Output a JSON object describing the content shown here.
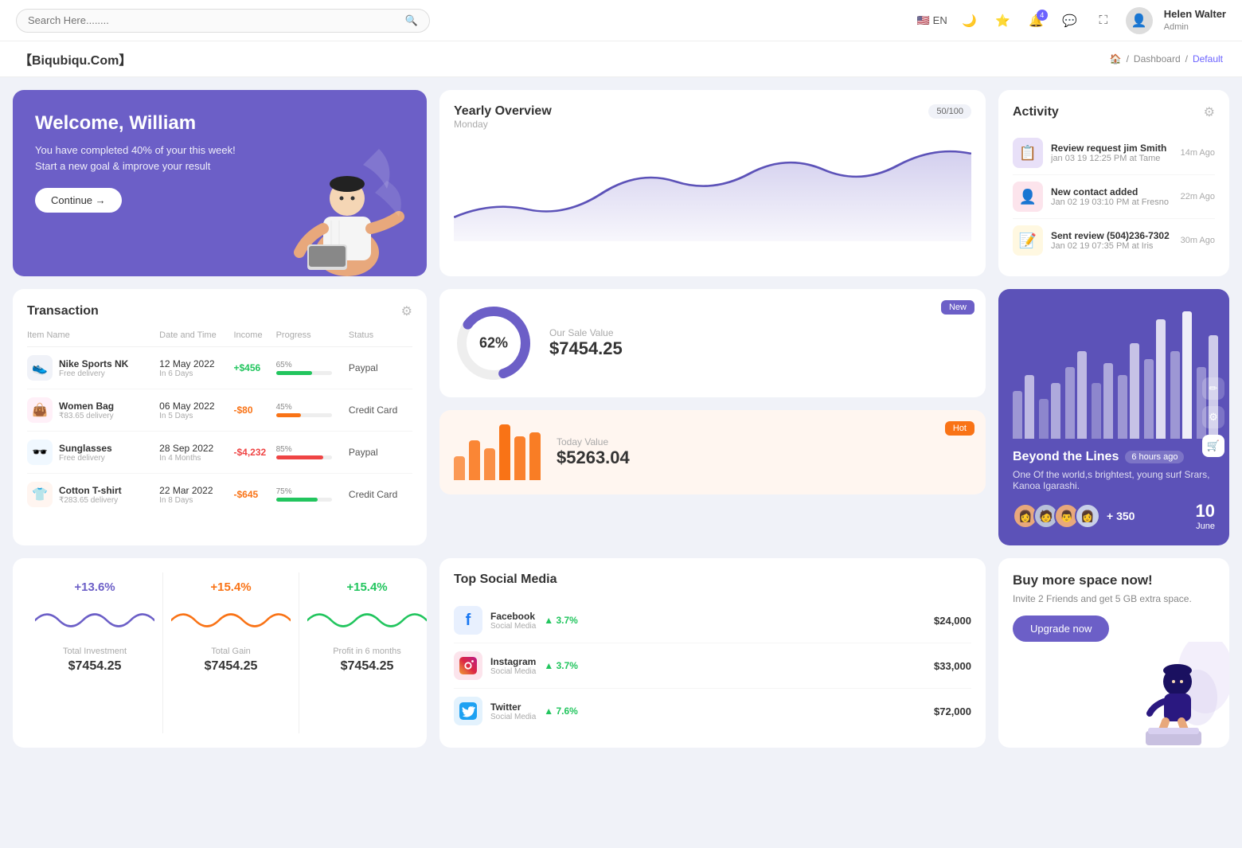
{
  "topnav": {
    "search_placeholder": "Search Here........",
    "lang": "EN",
    "notification_count": "4",
    "user_name": "Helen Walter",
    "user_role": "Admin"
  },
  "breadcrumb": {
    "logo": "【Biqubiqu.Com】",
    "home": "Home",
    "dashboard": "Dashboard",
    "current": "Default"
  },
  "welcome": {
    "title": "Welcome, William",
    "subtitle": "You have completed 40% of your this week! Start a new goal & improve your result",
    "btn_label": "Continue →"
  },
  "yearly_overview": {
    "title": "Yearly Overview",
    "subtitle": "Monday",
    "badge": "50/100"
  },
  "activity": {
    "title": "Activity",
    "items": [
      {
        "title": "Review request jim Smith",
        "sub": "jan 03 19 12:25 PM at Tame",
        "time": "14m Ago"
      },
      {
        "title": "New contact added",
        "sub": "Jan 02 19 03:10 PM at Fresno",
        "time": "22m Ago"
      },
      {
        "title": "Sent review (504)236-7302",
        "sub": "Jan 02 19 07:35 PM at Iris",
        "time": "30m Ago"
      }
    ]
  },
  "transaction": {
    "title": "Transaction",
    "columns": [
      "Item Name",
      "Date and Time",
      "Income",
      "Progress",
      "Status"
    ],
    "rows": [
      {
        "icon": "👟",
        "icon_bg": "#f0f2f8",
        "name": "Nike Sports NK",
        "sub": "Free delivery",
        "date": "12 May 2022",
        "days": "In 6 Days",
        "income": "+$456",
        "income_class": "income-pos",
        "progress": 65,
        "progress_color": "#22c55e",
        "status": "Paypal"
      },
      {
        "icon": "👜",
        "icon_bg": "#fff0f8",
        "name": "Women Bag",
        "sub": "₹83.65 delivery",
        "date": "06 May 2022",
        "days": "In 5 Days",
        "income": "-$80",
        "income_class": "income-neg",
        "progress": 45,
        "progress_color": "#f97316",
        "status": "Credit Card"
      },
      {
        "icon": "🕶️",
        "icon_bg": "#f0f8ff",
        "name": "Sunglasses",
        "sub": "Free delivery",
        "date": "28 Sep 2022",
        "days": "In 4 Months",
        "income": "-$4,232",
        "income_class": "income-neg2",
        "progress": 85,
        "progress_color": "#ef4444",
        "status": "Paypal"
      },
      {
        "icon": "👕",
        "icon_bg": "#fff5f0",
        "name": "Cotton T-shirt",
        "sub": "₹283.65 delivery",
        "date": "22 Mar 2022",
        "days": "In 8 Days",
        "income": "-$645",
        "income_class": "income-neg",
        "progress": 75,
        "progress_color": "#22c55e",
        "status": "Credit Card"
      }
    ]
  },
  "sale_value": {
    "badge": "New",
    "pct": "62%",
    "label": "Our Sale Value",
    "value": "$7454.25"
  },
  "today_value": {
    "badge": "Hot",
    "label": "Today Value",
    "value": "$5263.04",
    "bars": [
      30,
      50,
      40,
      70,
      55,
      60
    ]
  },
  "beyond": {
    "title": "Beyond the Lines",
    "time": "6 hours ago",
    "desc": "One Of the world,s brightest, young surf Srars, Kanoa Igarashi.",
    "plus_count": "+ 350",
    "date_num": "10",
    "date_month": "June"
  },
  "stats": [
    {
      "pct": "+13.6%",
      "pct_color": "#6c5fc7",
      "label": "Total Investment",
      "value": "$7454.25"
    },
    {
      "pct": "+15.4%",
      "pct_color": "#f97316",
      "label": "Total Gain",
      "value": "$7454.25"
    },
    {
      "pct": "+15.4%",
      "pct_color": "#22c55e",
      "label": "Profit in 6 months",
      "value": "$7454.25"
    }
  ],
  "social": {
    "title": "Top Social Media",
    "items": [
      {
        "icon": "f",
        "icon_color": "#1877f2",
        "icon_bg": "#e8f0fe",
        "name": "Facebook",
        "sub": "Social Media",
        "pct": "3.7%",
        "value": "$24,000"
      },
      {
        "icon": "📷",
        "icon_color": "#e1306c",
        "icon_bg": "#fce4ec",
        "name": "Instagram",
        "sub": "Social Media",
        "pct": "3.7%",
        "value": "$33,000"
      },
      {
        "icon": "t",
        "icon_color": "#1da1f2",
        "icon_bg": "#e3f2fd",
        "name": "Twitter",
        "sub": "Social Media",
        "pct": "7.6%",
        "value": "$72,000"
      }
    ]
  },
  "buy_space": {
    "title": "Buy more space now!",
    "desc": "Invite 2 Friends and get 5 GB extra space.",
    "btn_label": "Upgrade now"
  }
}
